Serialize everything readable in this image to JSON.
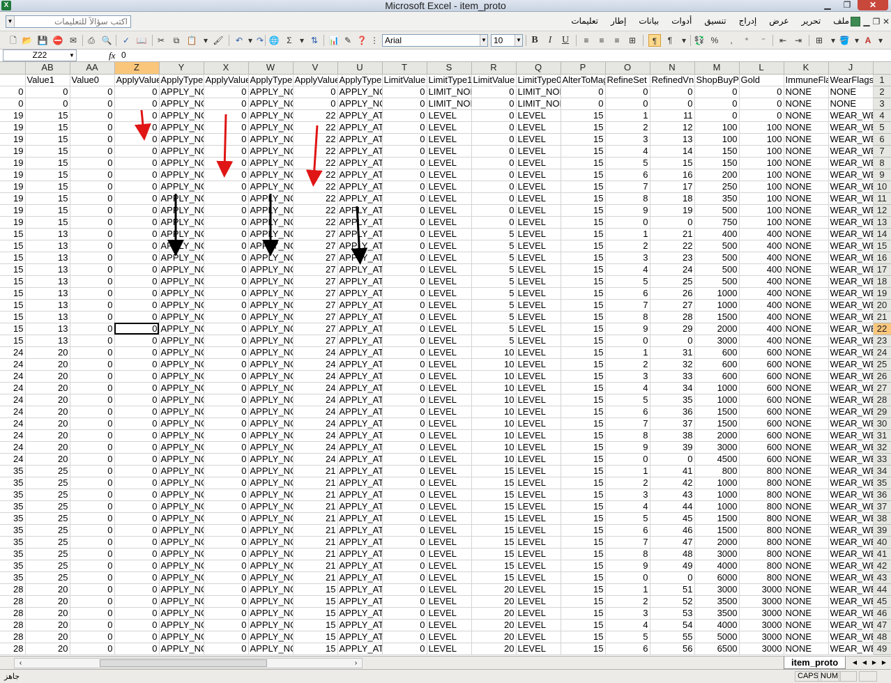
{
  "window": {
    "title": "Microsoft Excel - item_proto",
    "app_icon": "X"
  },
  "menubar": {
    "help_placeholder": "اكتب سؤالاً للتعليمات",
    "items": [
      "ملف",
      "تحرير",
      "عرض",
      "إدراج",
      "تنسيق",
      "أدوات",
      "بيانات",
      "إطار",
      "تعليمات"
    ]
  },
  "toolbar": {
    "font_name": "Arial",
    "font_size": "10"
  },
  "formula_bar": {
    "name_box": "Z22",
    "fx": "fx",
    "value": "0"
  },
  "sheet": {
    "column_letters": [
      "AB",
      "AA",
      "Z",
      "Y",
      "X",
      "W",
      "V",
      "U",
      "T",
      "S",
      "R",
      "Q",
      "P",
      "O",
      "N",
      "M",
      "L",
      "K",
      "J"
    ],
    "header_row": [
      "Value1",
      "Value0",
      "ApplyValue",
      "ApplyType",
      "ApplyValue",
      "ApplyType",
      "ApplyValue",
      "ApplyType",
      "LimitValue",
      "LimitType1",
      "LimitValue",
      "LimitType0",
      "AlterToMagic",
      "RefineSet",
      "RefinedVnum",
      "ShopBuyPrice",
      "Gold",
      "ImmuneFlag",
      "WearFlags"
    ],
    "row_numbers": [
      1,
      2,
      3,
      4,
      5,
      6,
      7,
      8,
      9,
      10,
      11,
      12,
      13,
      14,
      15,
      16,
      17,
      18,
      19,
      20,
      21,
      22,
      23,
      24,
      25,
      26,
      27,
      28,
      29,
      30,
      31,
      32,
      33,
      34,
      35,
      36,
      37,
      38,
      39,
      40,
      41,
      42,
      43,
      44,
      45,
      46,
      47,
      48,
      49
    ],
    "partial_col": [
      "",
      "0",
      "0",
      "19",
      "19",
      "19",
      "19",
      "19",
      "19",
      "19",
      "19",
      "19",
      "19",
      "15",
      "15",
      "15",
      "15",
      "15",
      "15",
      "15",
      "15",
      "15",
      "15",
      "24",
      "24",
      "24",
      "24",
      "24",
      "24",
      "24",
      "24",
      "24",
      "24",
      "35",
      "35",
      "35",
      "35",
      "35",
      "35",
      "35",
      "35",
      "35",
      "35",
      "28",
      "28",
      "28",
      "28",
      "28",
      "28"
    ],
    "rows": [
      [
        "0",
        "0",
        "0",
        "APPLY_NONE",
        "0",
        "APPLY_NONE",
        "0",
        "APPLY_NONE",
        "0",
        "LIMIT_NONE",
        "0",
        "LIMIT_NONE",
        "0",
        "0",
        "0",
        "0",
        "0",
        "NONE",
        "NONE"
      ],
      [
        "0",
        "0",
        "0",
        "APPLY_NONE",
        "0",
        "APPLY_NONE",
        "0",
        "APPLY_NONE",
        "0",
        "LIMIT_NONE",
        "0",
        "LIMIT_NONE",
        "0",
        "0",
        "0",
        "0",
        "0",
        "NONE",
        "NONE"
      ],
      [
        "15",
        "0",
        "0",
        "APPLY_NONE",
        "0",
        "APPLY_NONE",
        "22",
        "APPLY_ATT",
        "0",
        "LEVEL",
        "0",
        "LEVEL",
        "15",
        "1",
        "11",
        "0",
        "0",
        "NONE",
        "WEAR_WEAPON"
      ],
      [
        "15",
        "0",
        "0",
        "APPLY_NONE",
        "0",
        "APPLY_NONE",
        "22",
        "APPLY_ATT",
        "0",
        "LEVEL",
        "0",
        "LEVEL",
        "15",
        "2",
        "12",
        "100",
        "100",
        "NONE",
        "WEAR_WEAPON"
      ],
      [
        "15",
        "0",
        "0",
        "APPLY_NONE",
        "0",
        "APPLY_NONE",
        "22",
        "APPLY_ATT",
        "0",
        "LEVEL",
        "0",
        "LEVEL",
        "15",
        "3",
        "13",
        "100",
        "100",
        "NONE",
        "WEAR_WEAPON"
      ],
      [
        "15",
        "0",
        "0",
        "APPLY_NONE",
        "0",
        "APPLY_NONE",
        "22",
        "APPLY_ATT",
        "0",
        "LEVEL",
        "0",
        "LEVEL",
        "15",
        "4",
        "14",
        "150",
        "100",
        "NONE",
        "WEAR_WEAPON"
      ],
      [
        "15",
        "0",
        "0",
        "APPLY_NONE",
        "0",
        "APPLY_NONE",
        "22",
        "APPLY_ATT",
        "0",
        "LEVEL",
        "0",
        "LEVEL",
        "15",
        "5",
        "15",
        "150",
        "100",
        "NONE",
        "WEAR_WEAPON"
      ],
      [
        "15",
        "0",
        "0",
        "APPLY_NONE",
        "0",
        "APPLY_NONE",
        "22",
        "APPLY_ATT",
        "0",
        "LEVEL",
        "0",
        "LEVEL",
        "15",
        "6",
        "16",
        "200",
        "100",
        "NONE",
        "WEAR_WEAPON"
      ],
      [
        "15",
        "0",
        "0",
        "APPLY_NONE",
        "0",
        "APPLY_NONE",
        "22",
        "APPLY_ATT",
        "0",
        "LEVEL",
        "0",
        "LEVEL",
        "15",
        "7",
        "17",
        "250",
        "100",
        "NONE",
        "WEAR_WEAPON"
      ],
      [
        "15",
        "0",
        "0",
        "APPLY_NONE",
        "0",
        "APPLY_NONE",
        "22",
        "APPLY_ATT",
        "0",
        "LEVEL",
        "0",
        "LEVEL",
        "15",
        "8",
        "18",
        "350",
        "100",
        "NONE",
        "WEAR_WEAPON"
      ],
      [
        "15",
        "0",
        "0",
        "APPLY_NONE",
        "0",
        "APPLY_NONE",
        "22",
        "APPLY_ATT",
        "0",
        "LEVEL",
        "0",
        "LEVEL",
        "15",
        "9",
        "19",
        "500",
        "100",
        "NONE",
        "WEAR_WEAPON"
      ],
      [
        "15",
        "0",
        "0",
        "APPLY_NONE",
        "0",
        "APPLY_NONE",
        "22",
        "APPLY_ATT",
        "0",
        "LEVEL",
        "0",
        "LEVEL",
        "15",
        "0",
        "0",
        "750",
        "100",
        "NONE",
        "WEAR_WEAPON"
      ],
      [
        "13",
        "0",
        "0",
        "APPLY_NONE",
        "0",
        "APPLY_NONE",
        "27",
        "APPLY_ATT",
        "0",
        "LEVEL",
        "5",
        "LEVEL",
        "15",
        "1",
        "21",
        "400",
        "400",
        "NONE",
        "WEAR_WEAPON"
      ],
      [
        "13",
        "0",
        "0",
        "APPLY_NONE",
        "0",
        "APPLY_NONE",
        "27",
        "APPLY_ATT",
        "0",
        "LEVEL",
        "5",
        "LEVEL",
        "15",
        "2",
        "22",
        "500",
        "400",
        "NONE",
        "WEAR_WEAPON"
      ],
      [
        "13",
        "0",
        "0",
        "APPLY_NONE",
        "0",
        "APPLY_NONE",
        "27",
        "APPLY_ATT",
        "0",
        "LEVEL",
        "5",
        "LEVEL",
        "15",
        "3",
        "23",
        "500",
        "400",
        "NONE",
        "WEAR_WEAPON"
      ],
      [
        "13",
        "0",
        "0",
        "APPLY_NONE",
        "0",
        "APPLY_NONE",
        "27",
        "APPLY_ATT",
        "0",
        "LEVEL",
        "5",
        "LEVEL",
        "15",
        "4",
        "24",
        "500",
        "400",
        "NONE",
        "WEAR_WEAPON"
      ],
      [
        "13",
        "0",
        "0",
        "APPLY_NONE",
        "0",
        "APPLY_NONE",
        "27",
        "APPLY_ATT",
        "0",
        "LEVEL",
        "5",
        "LEVEL",
        "15",
        "5",
        "25",
        "500",
        "400",
        "NONE",
        "WEAR_WEAPON"
      ],
      [
        "13",
        "0",
        "0",
        "APPLY_NONE",
        "0",
        "APPLY_NONE",
        "27",
        "APPLY_ATT",
        "0",
        "LEVEL",
        "5",
        "LEVEL",
        "15",
        "6",
        "26",
        "1000",
        "400",
        "NONE",
        "WEAR_WEAPON"
      ],
      [
        "13",
        "0",
        "0",
        "APPLY_NONE",
        "0",
        "APPLY_NONE",
        "27",
        "APPLY_ATT",
        "0",
        "LEVEL",
        "5",
        "LEVEL",
        "15",
        "7",
        "27",
        "1000",
        "400",
        "NONE",
        "WEAR_WEAPON"
      ],
      [
        "13",
        "0",
        "0",
        "APPLY_NONE",
        "0",
        "APPLY_NONE",
        "27",
        "APPLY_ATT",
        "0",
        "LEVEL",
        "5",
        "LEVEL",
        "15",
        "8",
        "28",
        "1500",
        "400",
        "NONE",
        "WEAR_WEAPON"
      ],
      [
        "13",
        "0",
        "0",
        "APPLY_NONE",
        "0",
        "APPLY_NONE",
        "27",
        "APPLY_ATT",
        "0",
        "LEVEL",
        "5",
        "LEVEL",
        "15",
        "9",
        "29",
        "2000",
        "400",
        "NONE",
        "WEAR_WEAPON"
      ],
      [
        "13",
        "0",
        "0",
        "APPLY_NONE",
        "0",
        "APPLY_NONE",
        "27",
        "APPLY_ATT",
        "0",
        "LEVEL",
        "5",
        "LEVEL",
        "15",
        "0",
        "0",
        "3000",
        "400",
        "NONE",
        "WEAR_WEAPON"
      ],
      [
        "20",
        "0",
        "0",
        "APPLY_NONE",
        "0",
        "APPLY_NONE",
        "24",
        "APPLY_ATT",
        "0",
        "LEVEL",
        "10",
        "LEVEL",
        "15",
        "1",
        "31",
        "600",
        "600",
        "NONE",
        "WEAR_WEAPON"
      ],
      [
        "20",
        "0",
        "0",
        "APPLY_NONE",
        "0",
        "APPLY_NONE",
        "24",
        "APPLY_ATT",
        "0",
        "LEVEL",
        "10",
        "LEVEL",
        "15",
        "2",
        "32",
        "600",
        "600",
        "NONE",
        "WEAR_WEAPON"
      ],
      [
        "20",
        "0",
        "0",
        "APPLY_NONE",
        "0",
        "APPLY_NONE",
        "24",
        "APPLY_ATT",
        "0",
        "LEVEL",
        "10",
        "LEVEL",
        "15",
        "3",
        "33",
        "600",
        "600",
        "NONE",
        "WEAR_WEAPON"
      ],
      [
        "20",
        "0",
        "0",
        "APPLY_NONE",
        "0",
        "APPLY_NONE",
        "24",
        "APPLY_ATT",
        "0",
        "LEVEL",
        "10",
        "LEVEL",
        "15",
        "4",
        "34",
        "1000",
        "600",
        "NONE",
        "WEAR_WEAPON"
      ],
      [
        "20",
        "0",
        "0",
        "APPLY_NONE",
        "0",
        "APPLY_NONE",
        "24",
        "APPLY_ATT",
        "0",
        "LEVEL",
        "10",
        "LEVEL",
        "15",
        "5",
        "35",
        "1000",
        "600",
        "NONE",
        "WEAR_WEAPON"
      ],
      [
        "20",
        "0",
        "0",
        "APPLY_NONE",
        "0",
        "APPLY_NONE",
        "24",
        "APPLY_ATT",
        "0",
        "LEVEL",
        "10",
        "LEVEL",
        "15",
        "6",
        "36",
        "1500",
        "600",
        "NONE",
        "WEAR_WEAPON"
      ],
      [
        "20",
        "0",
        "0",
        "APPLY_NONE",
        "0",
        "APPLY_NONE",
        "24",
        "APPLY_ATT",
        "0",
        "LEVEL",
        "10",
        "LEVEL",
        "15",
        "7",
        "37",
        "1500",
        "600",
        "NONE",
        "WEAR_WEAPON"
      ],
      [
        "20",
        "0",
        "0",
        "APPLY_NONE",
        "0",
        "APPLY_NONE",
        "24",
        "APPLY_ATT",
        "0",
        "LEVEL",
        "10",
        "LEVEL",
        "15",
        "8",
        "38",
        "2000",
        "600",
        "NONE",
        "WEAR_WEAPON"
      ],
      [
        "20",
        "0",
        "0",
        "APPLY_NONE",
        "0",
        "APPLY_NONE",
        "24",
        "APPLY_ATT",
        "0",
        "LEVEL",
        "10",
        "LEVEL",
        "15",
        "9",
        "39",
        "3000",
        "600",
        "NONE",
        "WEAR_WEAPON"
      ],
      [
        "20",
        "0",
        "0",
        "APPLY_NONE",
        "0",
        "APPLY_NONE",
        "24",
        "APPLY_ATT",
        "0",
        "LEVEL",
        "10",
        "LEVEL",
        "15",
        "0",
        "0",
        "4500",
        "600",
        "NONE",
        "WEAR_WEAPON"
      ],
      [
        "25",
        "0",
        "0",
        "APPLY_NONE",
        "0",
        "APPLY_NONE",
        "21",
        "APPLY_ATT",
        "0",
        "LEVEL",
        "15",
        "LEVEL",
        "15",
        "1",
        "41",
        "800",
        "800",
        "NONE",
        "WEAR_WEAPON"
      ],
      [
        "25",
        "0",
        "0",
        "APPLY_NONE",
        "0",
        "APPLY_NONE",
        "21",
        "APPLY_ATT",
        "0",
        "LEVEL",
        "15",
        "LEVEL",
        "15",
        "2",
        "42",
        "1000",
        "800",
        "NONE",
        "WEAR_WEAPON"
      ],
      [
        "25",
        "0",
        "0",
        "APPLY_NONE",
        "0",
        "APPLY_NONE",
        "21",
        "APPLY_ATT",
        "0",
        "LEVEL",
        "15",
        "LEVEL",
        "15",
        "3",
        "43",
        "1000",
        "800",
        "NONE",
        "WEAR_WEAPON"
      ],
      [
        "25",
        "0",
        "0",
        "APPLY_NONE",
        "0",
        "APPLY_NONE",
        "21",
        "APPLY_ATT",
        "0",
        "LEVEL",
        "15",
        "LEVEL",
        "15",
        "4",
        "44",
        "1000",
        "800",
        "NONE",
        "WEAR_WEAPON"
      ],
      [
        "25",
        "0",
        "0",
        "APPLY_NONE",
        "0",
        "APPLY_NONE",
        "21",
        "APPLY_ATT",
        "0",
        "LEVEL",
        "15",
        "LEVEL",
        "15",
        "5",
        "45",
        "1500",
        "800",
        "NONE",
        "WEAR_WEAPON"
      ],
      [
        "25",
        "0",
        "0",
        "APPLY_NONE",
        "0",
        "APPLY_NONE",
        "21",
        "APPLY_ATT",
        "0",
        "LEVEL",
        "15",
        "LEVEL",
        "15",
        "6",
        "46",
        "1500",
        "800",
        "NONE",
        "WEAR_WEAPON"
      ],
      [
        "25",
        "0",
        "0",
        "APPLY_NONE",
        "0",
        "APPLY_NONE",
        "21",
        "APPLY_ATT",
        "0",
        "LEVEL",
        "15",
        "LEVEL",
        "15",
        "7",
        "47",
        "2000",
        "800",
        "NONE",
        "WEAR_WEAPON"
      ],
      [
        "25",
        "0",
        "0",
        "APPLY_NONE",
        "0",
        "APPLY_NONE",
        "21",
        "APPLY_ATT",
        "0",
        "LEVEL",
        "15",
        "LEVEL",
        "15",
        "8",
        "48",
        "3000",
        "800",
        "NONE",
        "WEAR_WEAPON"
      ],
      [
        "25",
        "0",
        "0",
        "APPLY_NONE",
        "0",
        "APPLY_NONE",
        "21",
        "APPLY_ATT",
        "0",
        "LEVEL",
        "15",
        "LEVEL",
        "15",
        "9",
        "49",
        "4000",
        "800",
        "NONE",
        "WEAR_WEAPON"
      ],
      [
        "25",
        "0",
        "0",
        "APPLY_NONE",
        "0",
        "APPLY_NONE",
        "21",
        "APPLY_ATT",
        "0",
        "LEVEL",
        "15",
        "LEVEL",
        "15",
        "0",
        "0",
        "6000",
        "800",
        "NONE",
        "WEAR_WEAPON"
      ],
      [
        "20",
        "0",
        "0",
        "APPLY_NONE",
        "0",
        "APPLY_NONE",
        "15",
        "APPLY_ATT",
        "0",
        "LEVEL",
        "20",
        "LEVEL",
        "15",
        "1",
        "51",
        "3000",
        "3000",
        "NONE",
        "WEAR_WEAPON"
      ],
      [
        "20",
        "0",
        "0",
        "APPLY_NONE",
        "0",
        "APPLY_NONE",
        "15",
        "APPLY_ATT",
        "0",
        "LEVEL",
        "20",
        "LEVEL",
        "15",
        "2",
        "52",
        "3500",
        "3000",
        "NONE",
        "WEAR_WEAPON"
      ],
      [
        "20",
        "0",
        "0",
        "APPLY_NONE",
        "0",
        "APPLY_NONE",
        "15",
        "APPLY_ATT",
        "0",
        "LEVEL",
        "20",
        "LEVEL",
        "15",
        "3",
        "53",
        "3500",
        "3000",
        "NONE",
        "WEAR_WEAPON"
      ],
      [
        "20",
        "0",
        "0",
        "APPLY_NONE",
        "0",
        "APPLY_NONE",
        "15",
        "APPLY_ATT",
        "0",
        "LEVEL",
        "20",
        "LEVEL",
        "15",
        "4",
        "54",
        "4000",
        "3000",
        "NONE",
        "WEAR_WEAPON"
      ],
      [
        "20",
        "0",
        "0",
        "APPLY_NONE",
        "0",
        "APPLY_NONE",
        "15",
        "APPLY_ATT",
        "0",
        "LEVEL",
        "20",
        "LEVEL",
        "15",
        "5",
        "55",
        "5000",
        "3000",
        "NONE",
        "WEAR_WEAPON"
      ],
      [
        "20",
        "0",
        "0",
        "APPLY_NONE",
        "0",
        "APPLY_NONE",
        "15",
        "APPLY_ATT",
        "0",
        "LEVEL",
        "20",
        "LEVEL",
        "15",
        "6",
        "56",
        "6500",
        "3000",
        "NONE",
        "WEAR_WEAPON"
      ]
    ],
    "selected_column": "Z",
    "selected_row": 22,
    "active_cell": "Z22"
  },
  "sheet_tabs": {
    "active": "item_proto"
  },
  "statusbar": {
    "ready": "جاهز",
    "caps": "CAPS",
    "num": "NUM"
  },
  "colors": {
    "selection": "#f9c67b",
    "arrow_red": "#e01515",
    "arrow_black": "#000000",
    "excel_green": "#1f7a3a"
  }
}
